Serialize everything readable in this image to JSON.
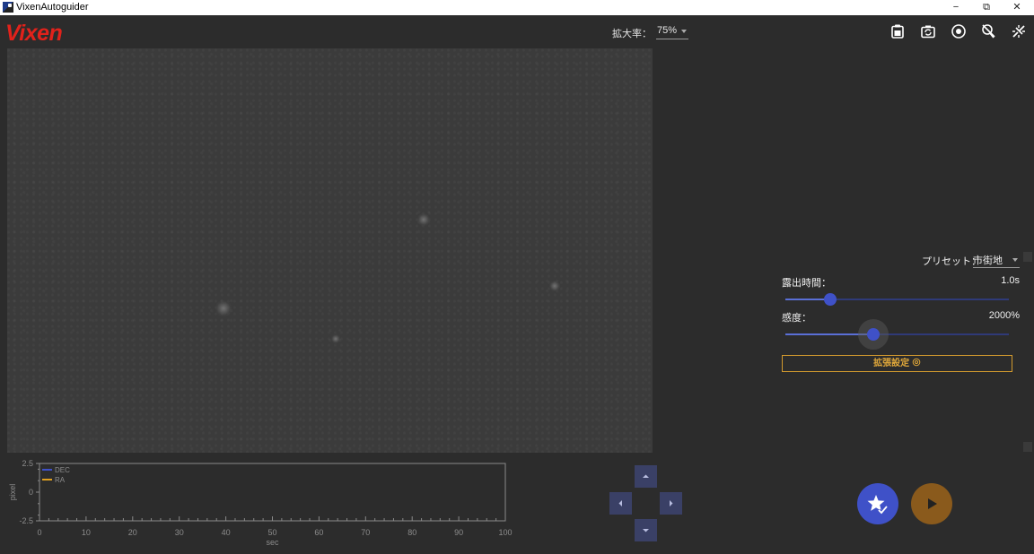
{
  "window": {
    "title": "VixenAutoguider",
    "controls": {
      "minimize": "−",
      "restore": "⧉",
      "close": "✕"
    }
  },
  "appbar": {
    "logo": "Vixen",
    "zoom_label": "拡大率：",
    "zoom_value": "75%",
    "tools": [
      {
        "icon": "clipboard-icon"
      },
      {
        "icon": "camera-rotate-icon"
      },
      {
        "icon": "target-icon"
      },
      {
        "icon": "reticle-off-icon"
      },
      {
        "icon": "disconnect-icon"
      }
    ]
  },
  "settings": {
    "preset_label": "プリセット：",
    "preset_value": "市街地",
    "exposure_label": "露出時間：",
    "exposure_value": "1.0s",
    "exposure_level": 0.2,
    "gain_label": "感度：",
    "gain_value": "2000%",
    "gain_level": 0.395,
    "advanced_button": "拡張設定",
    "advanced_icon": "gear-icon"
  },
  "chart_data": {
    "type": "line",
    "ylabel": "pixel",
    "xlabel": "sec",
    "xlim": [
      0,
      100
    ],
    "ylim": [
      -2.5,
      2.5
    ],
    "x_ticks": [
      "0",
      "10",
      "20",
      "30",
      "40",
      "50",
      "60",
      "70",
      "80",
      "90",
      "100"
    ],
    "y_ticks": [
      "2.5",
      "0",
      "-2.5"
    ],
    "series": [
      {
        "name": "DEC",
        "color": "#3f51c8",
        "values": []
      },
      {
        "name": "RA",
        "color": "#e0a020",
        "values": []
      }
    ],
    "legend": "top-left"
  },
  "colors": {
    "accent": "#3f51c8",
    "secondary": "#8a5a1c",
    "logo": "#e1221b",
    "advanced": "#d29a2e"
  },
  "actions": {
    "guide_icon": "star-check-icon",
    "play_icon": "play-icon"
  },
  "dpad": {
    "up": "arrow-up-icon",
    "down": "arrow-down-icon",
    "left": "arrow-left-icon",
    "right": "arrow-right-icon"
  }
}
